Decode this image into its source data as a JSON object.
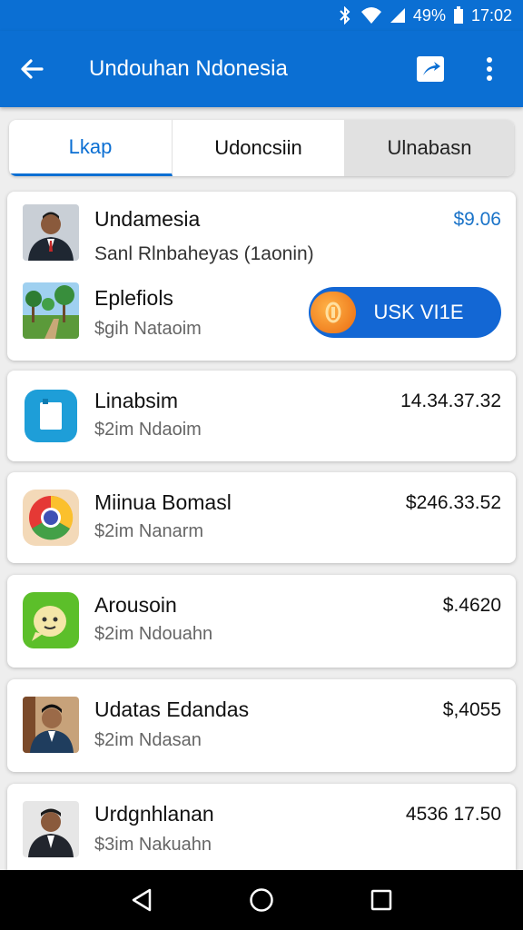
{
  "status_bar": {
    "battery_text": "49%",
    "time": "17:02"
  },
  "app_bar": {
    "title": "Undouhan Ndonesia"
  },
  "tabs": [
    {
      "label": "Lkap",
      "active": true
    },
    {
      "label": "Udoncsiin",
      "active": false
    },
    {
      "label": "Ulnabasn",
      "active": false
    }
  ],
  "featured": {
    "name": "Undamesia",
    "amount": "$9.06",
    "subtitle": "Sanl Rlnbaheyas (1aonin)",
    "second_name": "Eplefiols",
    "second_sub": "$gih Nataoim",
    "vote_label": "USK VI1E"
  },
  "items": [
    {
      "name": "Linabsim",
      "sub": "$2im Ndaoim",
      "amount": "14.34.37.32",
      "icon": "tablet-app-icon"
    },
    {
      "name": "Miinua Bomasl",
      "sub": "$2im Nanarm",
      "amount": "$246.33.52",
      "icon": "chrome-app-icon"
    },
    {
      "name": "Arousoin",
      "sub": "$2im Ndouahn",
      "amount": "$.4620",
      "icon": "chat-app-icon"
    },
    {
      "name": "Udatas Edandas",
      "sub": "$2im Ndasan",
      "amount": "$,4055",
      "icon": "avatar"
    },
    {
      "name": "Urdgnhlanan",
      "sub": "$3im Nakuahn",
      "amount": "4536 17.50",
      "icon": "avatar"
    }
  ],
  "colors": {
    "primary": "#0b6fd3",
    "accent": "#1367d4",
    "amount_highlight": "#1a73c8",
    "coin": "#ea6a10"
  }
}
